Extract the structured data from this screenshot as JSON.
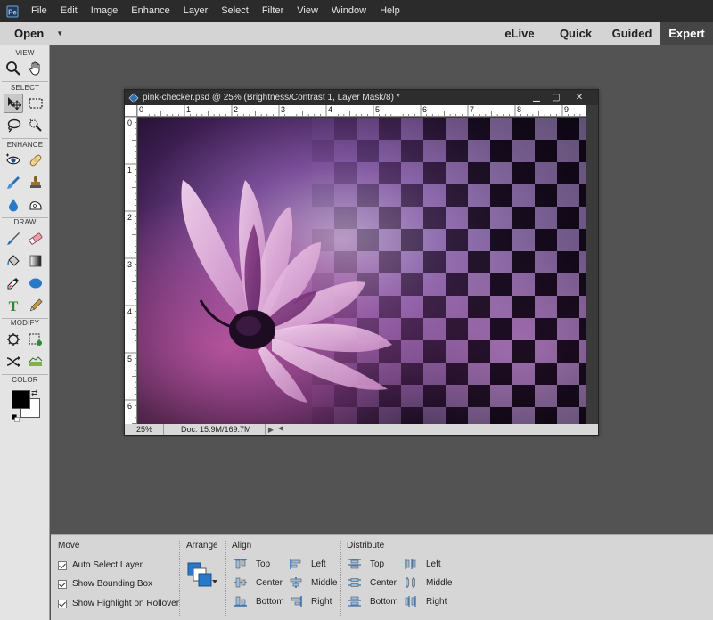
{
  "menubar": {
    "items": [
      "File",
      "Edit",
      "Image",
      "Enhance",
      "Layer",
      "Select",
      "Filter",
      "View",
      "Window",
      "Help"
    ]
  },
  "modebar": {
    "open_label": "Open",
    "tabs": [
      {
        "label": "eLive",
        "active": false
      },
      {
        "label": "Quick",
        "active": false
      },
      {
        "label": "Guided",
        "active": false
      },
      {
        "label": "Expert",
        "active": true
      }
    ]
  },
  "toolbar": {
    "sections": {
      "view": "VIEW",
      "select": "SELECT",
      "enhance": "ENHANCE",
      "draw": "DRAW",
      "modify": "MODIFY",
      "color": "COLOR"
    },
    "tools": {
      "zoom": "zoom-tool",
      "hand": "hand-tool",
      "move": "move-tool",
      "marquee": "rectangular-marquee-tool",
      "lasso": "lasso-tool",
      "quick_select": "quick-selection-tool",
      "red_eye": "red-eye-tool",
      "spot_heal": "spot-healing-brush-tool",
      "smart_brush": "smart-brush-tool",
      "clone_stamp": "clone-stamp-tool",
      "blur": "blur-tool",
      "sponge": "sponge-tool",
      "brush": "brush-tool",
      "eraser": "eraser-tool",
      "paint_bucket": "paint-bucket-tool",
      "gradient": "gradient-tool",
      "eyedropper": "eyedropper-tool",
      "shape": "ellipse-tool",
      "type": "type-tool",
      "pencil": "pencil-tool",
      "crop": "crop-tool",
      "recompose": "recompose-tool",
      "content_aware_move": "content-aware-move-tool",
      "straighten": "straighten-tool"
    },
    "colors": {
      "foreground": "#000000",
      "background": "#ffffff"
    }
  },
  "document": {
    "title": "pink-checker.psd @ 25% (Brightness/Contrast 1, Layer Mask/8) *",
    "ruler_top": [
      "0",
      "1",
      "2",
      "3",
      "4",
      "5",
      "6",
      "7",
      "8",
      "9"
    ],
    "ruler_left": [
      "0",
      "1",
      "2",
      "3",
      "4",
      "5",
      "6"
    ],
    "zoom": "25%",
    "doc_size": "Doc: 15.9M/169.7M",
    "window_buttons": {
      "minimize": "▁",
      "restore": "▢",
      "close": "✕"
    }
  },
  "options": {
    "move": {
      "heading": "Move",
      "checks": [
        {
          "label": "Auto Select Layer",
          "checked": true
        },
        {
          "label": "Show Bounding Box",
          "checked": true
        },
        {
          "label": "Show Highlight on Rollover",
          "checked": true
        }
      ]
    },
    "arrange": {
      "heading": "Arrange"
    },
    "align": {
      "heading": "Align",
      "col1": [
        "Top",
        "Center",
        "Bottom"
      ],
      "col2": [
        "Left",
        "Middle",
        "Right"
      ]
    },
    "distribute": {
      "heading": "Distribute",
      "col1": [
        "Top",
        "Center",
        "Bottom"
      ],
      "col2": [
        "Left",
        "Middle",
        "Right"
      ]
    }
  }
}
